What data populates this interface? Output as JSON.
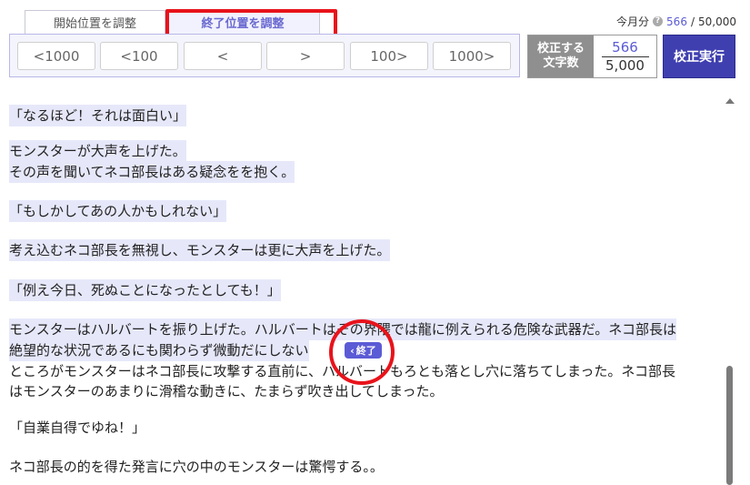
{
  "tabs": [
    {
      "label": "開始位置を調整",
      "active": false
    },
    {
      "label": "終了位置を調整",
      "active": true
    }
  ],
  "quota": {
    "label": "今月分",
    "used": "566",
    "separator": "/",
    "limit": "50,000"
  },
  "adjust_buttons": [
    {
      "label": "<1000"
    },
    {
      "label": "<100"
    },
    {
      "label": "<"
    },
    {
      "label": ">"
    },
    {
      "label": "100>"
    },
    {
      "label": "1000>"
    }
  ],
  "count_box": {
    "label_line1": "校正する",
    "label_line2": "文字数",
    "value": "566",
    "max": "5,000"
  },
  "run_button": {
    "label": "校正実行"
  },
  "end_marker": {
    "label": "終了",
    "icon": "chevron-left-icon"
  },
  "text_lines": [
    "「なるほど！それは面白い」",
    "モンスターが大声を上げた。",
    "その声を聞いてネコ部長はある疑念をを抱く。",
    "「もしかしてあの人かもしれない」",
    "考え込むネコ部長を無視し、モンスターは更に大声を上げた。",
    "「例え今日、死ぬことになったとしても！」",
    "モンスターはハルバートを振り上げた。ハルバートはその界隈では龍に例えられる危険な武器だ。ネコ部長は",
    "絶望的な状況であるにも関わらず微動だにしない",
    "ところがモンスターはネコ部長に攻撃する直前に、ハルバートもろとも落とし穴に落ちてしまった。ネコ部長",
    "はモンスターのあまりに滑稽な動きに、たまらず吹き出してしまった。",
    "「自業自得でゆね！」",
    "ネコ部長の的を得た発言に穴の中のモンスターは驚愕する。。"
  ],
  "colors": {
    "accent": "#5b5bd6",
    "highlight": "#e6e8fa",
    "annotation": "#e8131b",
    "run_button": "#3f3fb0"
  }
}
